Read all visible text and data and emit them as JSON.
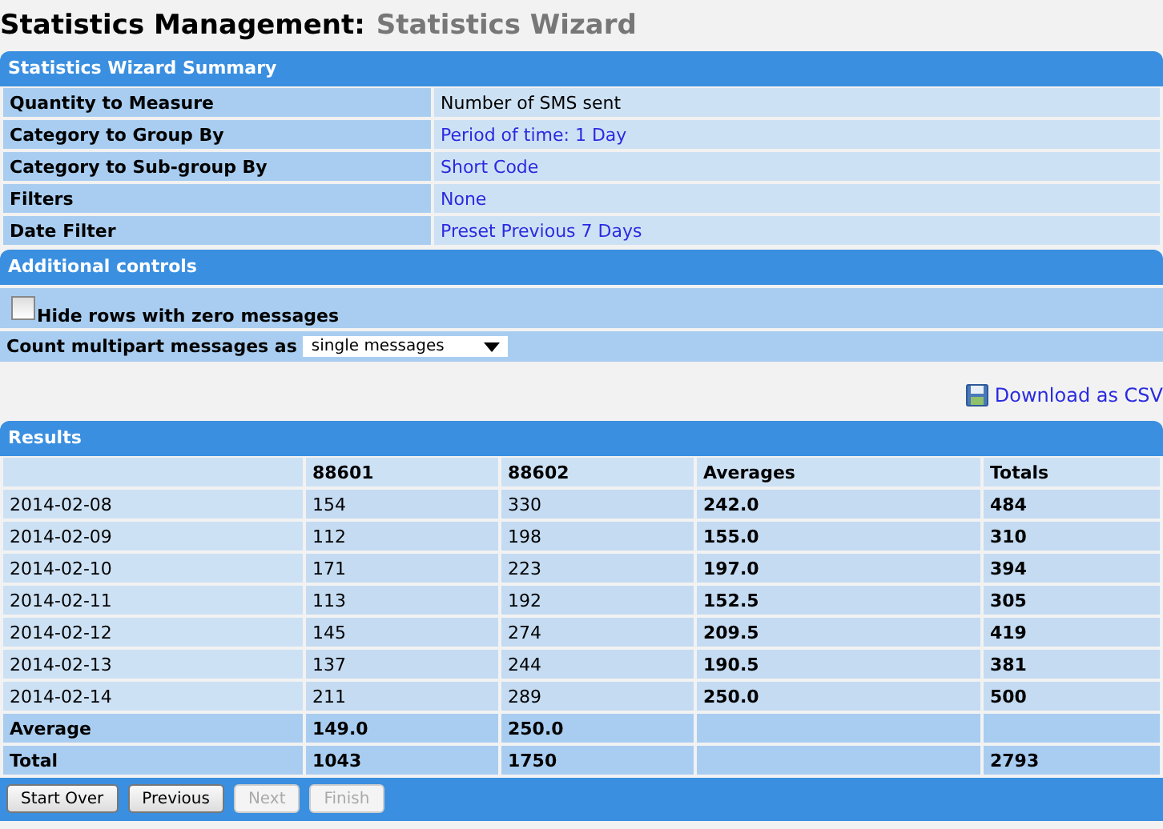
{
  "page_title": {
    "main": "Statistics Management:",
    "sub": "Statistics Wizard"
  },
  "summary": {
    "title": "Statistics Wizard Summary",
    "rows": [
      {
        "label": "Quantity to Measure",
        "value": "Number of SMS sent",
        "link": false
      },
      {
        "label": "Category to Group By",
        "value": "Period of time: 1 Day",
        "link": true
      },
      {
        "label": "Category to Sub-group By",
        "value": "Short Code",
        "link": true
      },
      {
        "label": "Filters",
        "value": "None",
        "link": true
      },
      {
        "label": "Date Filter",
        "value": "Preset Previous 7 Days",
        "link": true
      }
    ]
  },
  "controls": {
    "title": "Additional controls",
    "checkbox": {
      "label": "Hide rows with zero messages",
      "checked": false
    },
    "select": {
      "label": "Count multipart messages as",
      "value": "single messages"
    }
  },
  "download_link": "Download as CSV",
  "results": {
    "title": "Results",
    "columns": [
      "",
      "88601",
      "88602",
      "Averages",
      "Totals"
    ],
    "rows": [
      {
        "kind": "data",
        "cells": [
          "2014-02-08",
          "154",
          "330",
          "242.0",
          "484"
        ]
      },
      {
        "kind": "data",
        "cells": [
          "2014-02-09",
          "112",
          "198",
          "155.0",
          "310"
        ]
      },
      {
        "kind": "data",
        "cells": [
          "2014-02-10",
          "171",
          "223",
          "197.0",
          "394"
        ]
      },
      {
        "kind": "data",
        "cells": [
          "2014-02-11",
          "113",
          "192",
          "152.5",
          "305"
        ]
      },
      {
        "kind": "data",
        "cells": [
          "2014-02-12",
          "145",
          "274",
          "209.5",
          "419"
        ]
      },
      {
        "kind": "data",
        "cells": [
          "2014-02-13",
          "137",
          "244",
          "190.5",
          "381"
        ]
      },
      {
        "kind": "data",
        "cells": [
          "2014-02-14",
          "211",
          "289",
          "250.0",
          "500"
        ]
      },
      {
        "kind": "summary",
        "cells": [
          "Average",
          "149.0",
          "250.0",
          "",
          ""
        ]
      },
      {
        "kind": "summary",
        "cells": [
          "Total",
          "1043",
          "1750",
          "",
          "2793"
        ]
      }
    ]
  },
  "buttons": [
    {
      "label": "Start Over",
      "disabled": false
    },
    {
      "label": "Previous",
      "disabled": false
    },
    {
      "label": "Next",
      "disabled": true
    },
    {
      "label": "Finish",
      "disabled": true
    }
  ]
}
